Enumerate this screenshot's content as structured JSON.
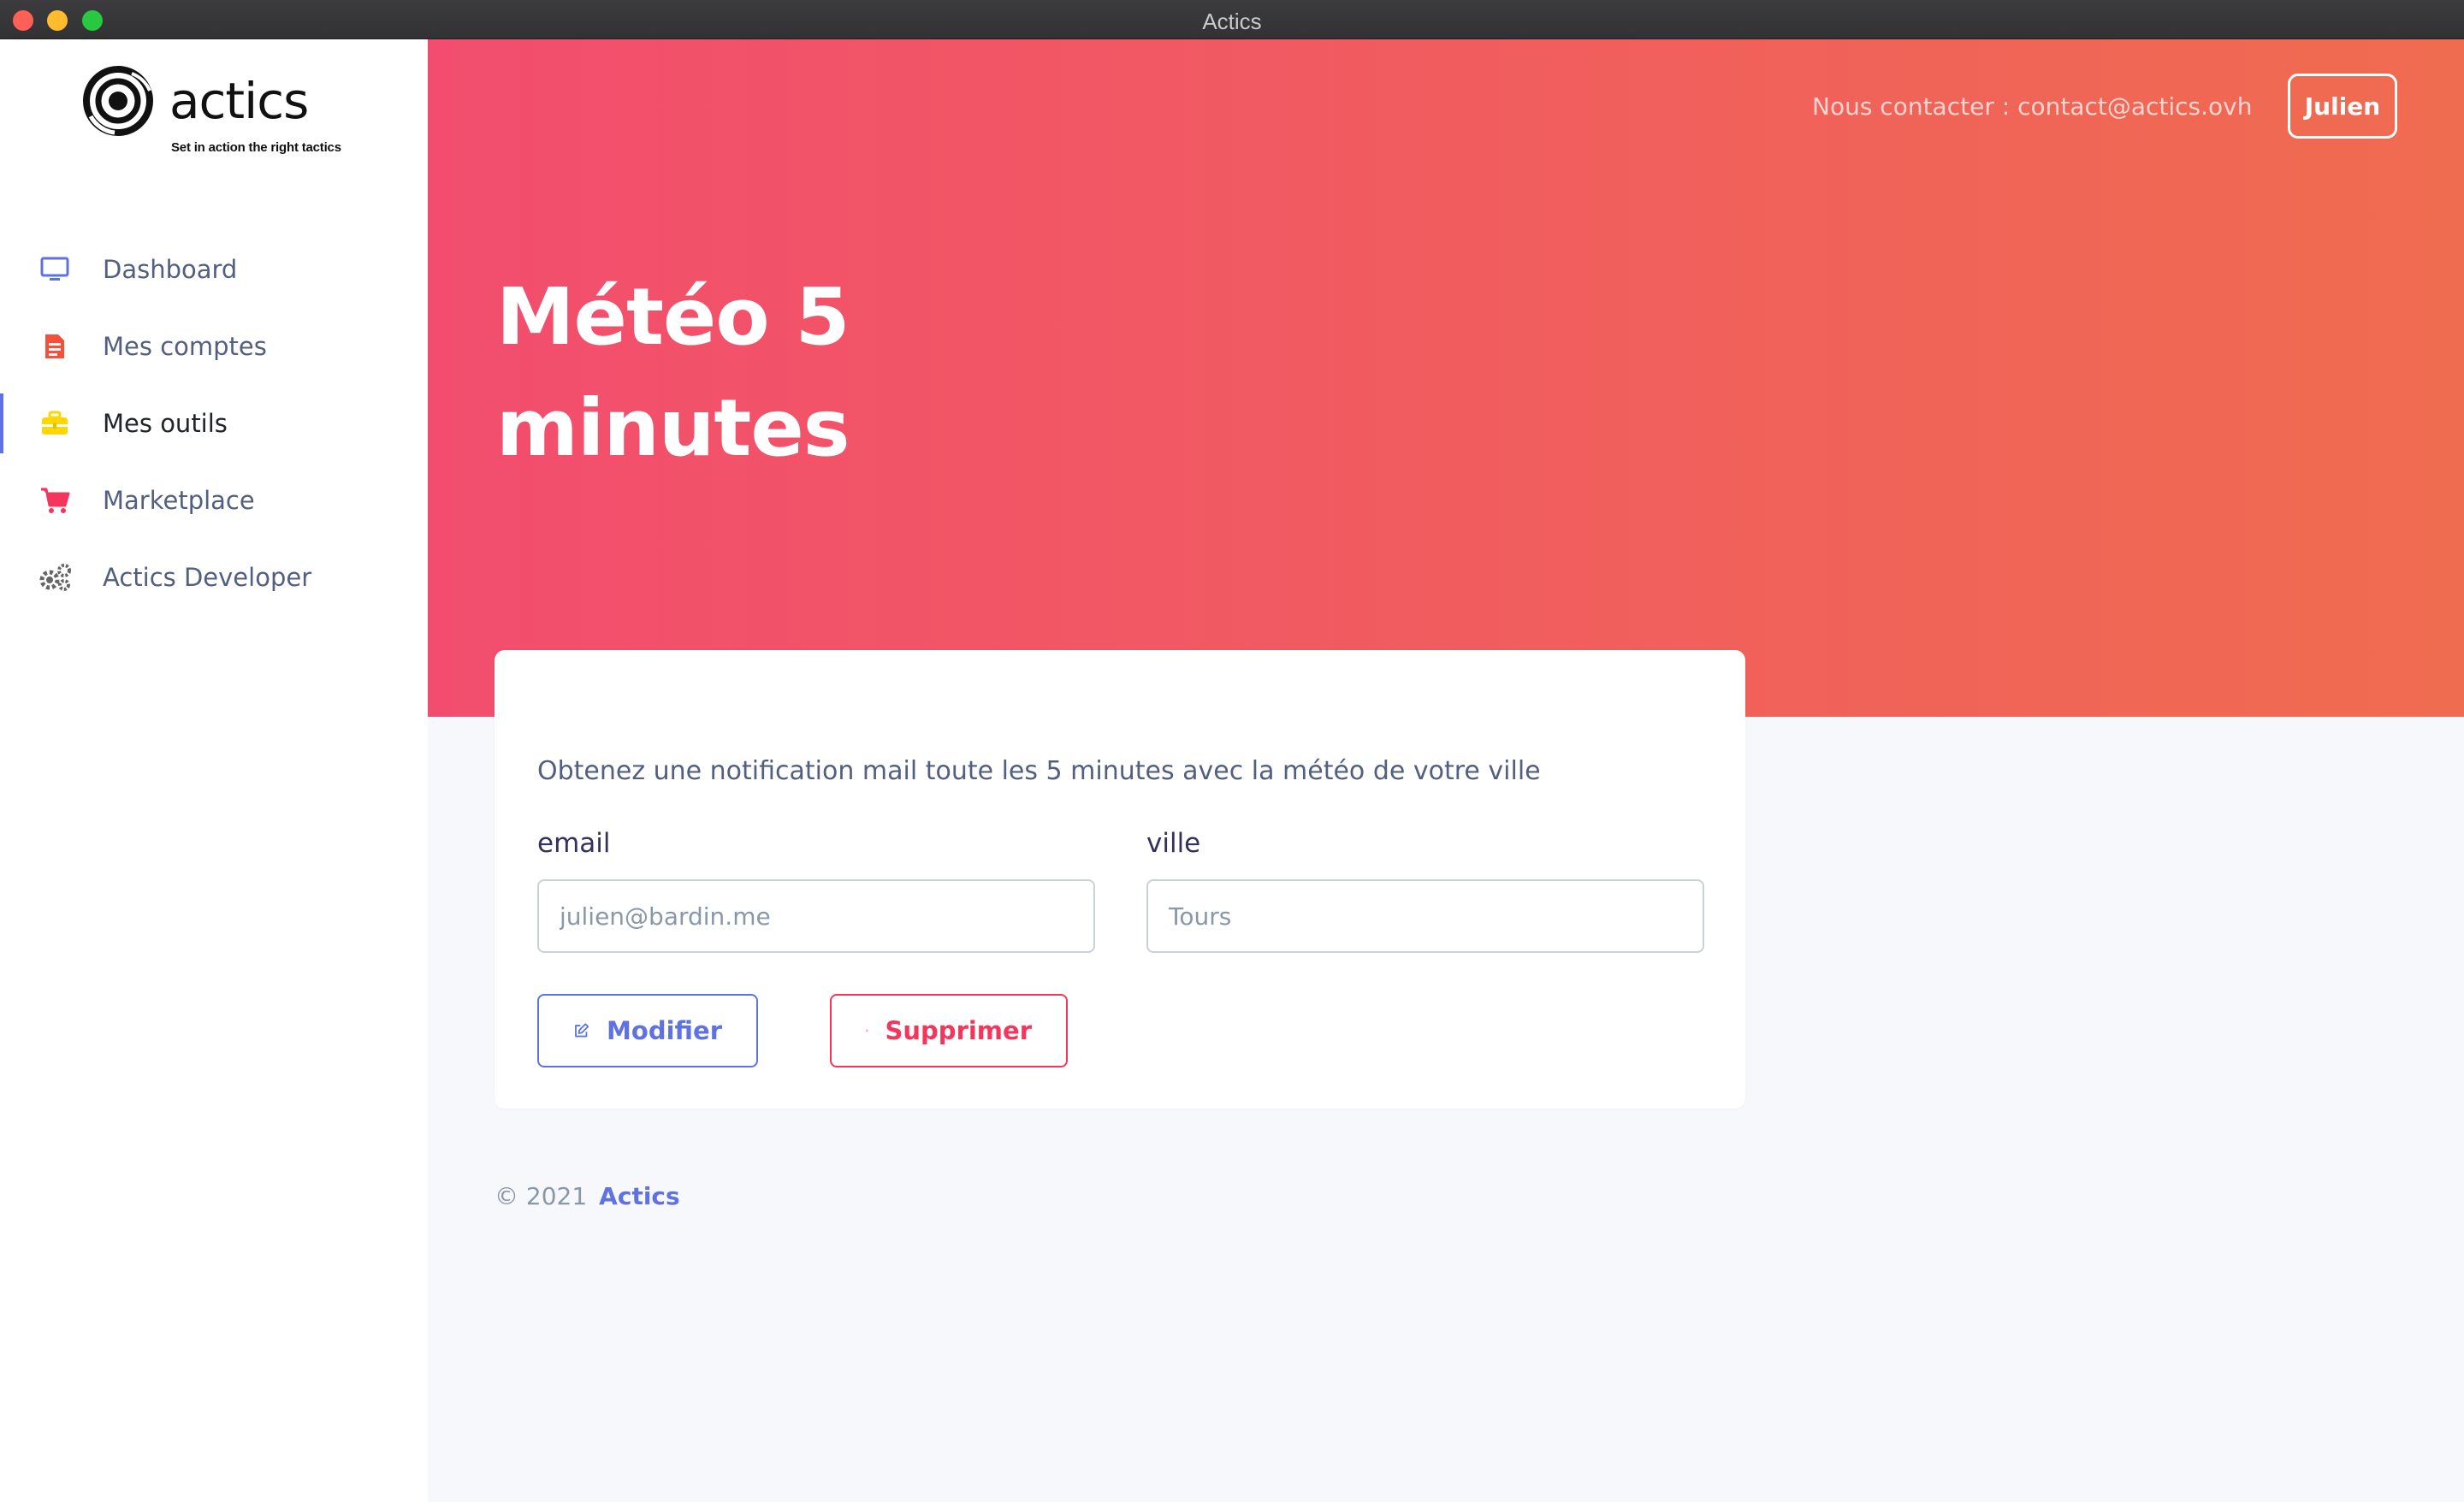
{
  "window": {
    "title": "Actics"
  },
  "brand": {
    "name": "actics",
    "tagline": "Set in action the right tactics"
  },
  "sidebar": {
    "items": [
      {
        "label": "Dashboard",
        "icon": "monitor-icon",
        "color": "#5e72e4",
        "active": false
      },
      {
        "label": "Mes comptes",
        "icon": "document-icon",
        "color": "#f5503c",
        "active": false
      },
      {
        "label": "Mes outils",
        "icon": "briefcase-icon",
        "color": "#ffd600",
        "active": true
      },
      {
        "label": "Marketplace",
        "icon": "cart-icon",
        "color": "#f5365c",
        "active": false
      },
      {
        "label": "Actics Developer",
        "icon": "gears-icon",
        "color": "#666666",
        "active": false
      }
    ]
  },
  "header": {
    "contact": "Nous contacter : contact@actics.ovh",
    "user_button": "Julien",
    "gradient": [
      "#f24d6e",
      "#f06c50"
    ]
  },
  "page": {
    "title": "Météo 5 minutes"
  },
  "card": {
    "description": "Obtenez une notification mail toute les 5 minutes avec la météo de votre ville",
    "email_label": "email",
    "email_placeholder": "julien@bardin.me",
    "ville_label": "ville",
    "ville_placeholder": "Tours",
    "modify_label": "Modifier",
    "delete_label": "Supprimer"
  },
  "footer": {
    "copyright": "© 2021",
    "brand": "Actics"
  },
  "colors": {
    "primary": "#5e72e4",
    "danger": "#f5365c"
  }
}
